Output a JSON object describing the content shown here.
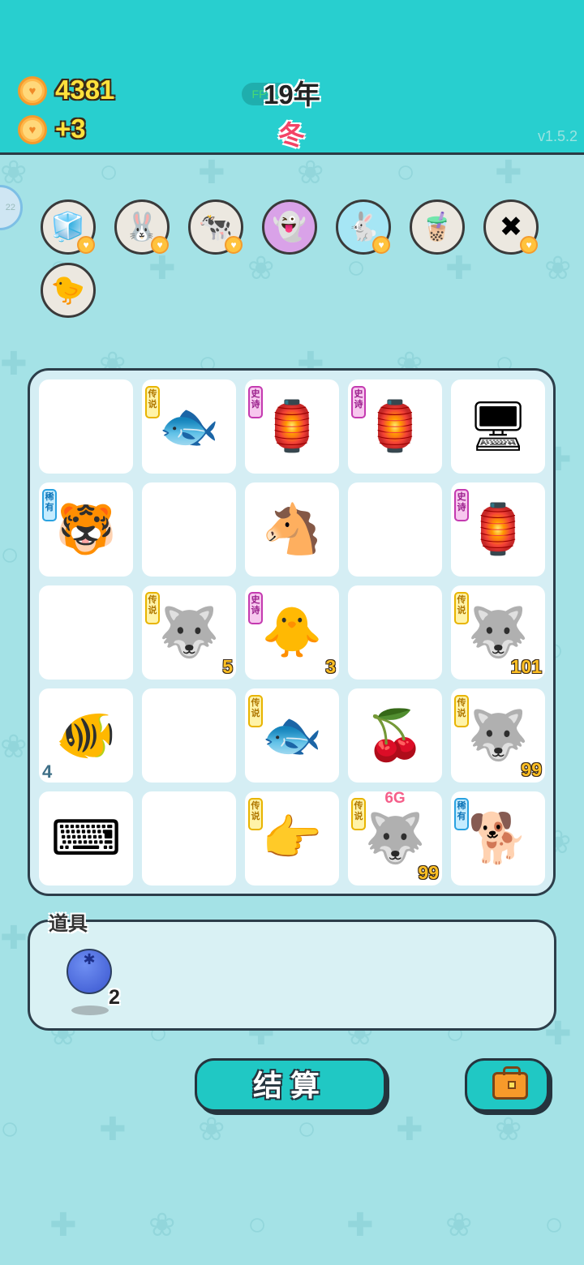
{
  "hud": {
    "coins": "4381",
    "income": "+3",
    "year": "19年",
    "season": "冬",
    "fps": "FPS:5",
    "version": "v1.5.2",
    "side_badge": "22"
  },
  "status_icons": [
    {
      "name": "sugar-cubes-icon",
      "glyph": "🧊",
      "heart": true
    },
    {
      "name": "rabbit-icon",
      "glyph": "🐰",
      "heart": true
    },
    {
      "name": "cow-pair-icon",
      "glyph": "🐄",
      "heart": true
    },
    {
      "name": "ghost-icon",
      "glyph": "👻",
      "heart": false
    },
    {
      "name": "rabbit-blue-icon",
      "glyph": "🐇",
      "heart": true
    },
    {
      "name": "bubble-tea-icon",
      "glyph": "🧋",
      "heart": false
    },
    {
      "name": "delete-tag-icon",
      "glyph": "✖",
      "heart": true
    },
    {
      "name": "chick-egg-icon",
      "glyph": "🐤",
      "heart": false
    }
  ],
  "rarity_labels": {
    "legend": "传说",
    "epic": "史诗",
    "rare": "稀有"
  },
  "board": [
    {
      "symbol": "",
      "name": "empty-cell",
      "rarity": null,
      "count": null
    },
    {
      "symbol": "🐟",
      "name": "koi-fish",
      "rarity": "legend",
      "count": null
    },
    {
      "symbol": "🏮",
      "name": "rabbit-lantern-tent",
      "rarity": "epic",
      "count": null
    },
    {
      "symbol": "🏮",
      "name": "rabbit-lantern-tent",
      "rarity": "epic",
      "count": null
    },
    {
      "symbol": "🖥",
      "name": "computer-monitor",
      "rarity": null,
      "count": null
    },
    {
      "symbol": "🐯",
      "name": "tiger",
      "rarity": "rare",
      "count": null
    },
    {
      "symbol": "",
      "name": "empty-cell",
      "rarity": null,
      "count": null
    },
    {
      "symbol": "🐴",
      "name": "horse",
      "rarity": null,
      "count": null
    },
    {
      "symbol": "",
      "name": "empty-cell",
      "rarity": null,
      "count": null
    },
    {
      "symbol": "🏮",
      "name": "rabbit-lantern-tent",
      "rarity": "epic",
      "count": null
    },
    {
      "symbol": "",
      "name": "empty-cell",
      "rarity": null,
      "count": null
    },
    {
      "symbol": "🐺",
      "name": "husky-king",
      "rarity": "legend",
      "count": "5"
    },
    {
      "symbol": "🐥",
      "name": "yellow-chick",
      "rarity": "epic",
      "count": "3"
    },
    {
      "symbol": "",
      "name": "empty-cell",
      "rarity": null,
      "count": null
    },
    {
      "symbol": "🐺",
      "name": "husky-king",
      "rarity": "legend",
      "count": "101"
    },
    {
      "symbol": "🐠",
      "name": "goldfish",
      "rarity": null,
      "count_left": "4"
    },
    {
      "symbol": "",
      "name": "empty-cell",
      "rarity": null,
      "count": null
    },
    {
      "symbol": "🐟",
      "name": "koi-fish",
      "rarity": "legend",
      "count": null
    },
    {
      "symbol": "🍒",
      "name": "cherry",
      "rarity": null,
      "count": null
    },
    {
      "symbol": "🐺",
      "name": "husky-king",
      "rarity": "legend",
      "count": "99"
    },
    {
      "symbol": "⌨",
      "name": "keyboard",
      "rarity": null,
      "count": null
    },
    {
      "symbol": "",
      "name": "empty-cell",
      "rarity": null,
      "count": null
    },
    {
      "symbol": "👉",
      "name": "pointing-hand",
      "rarity": "legend",
      "count": null
    },
    {
      "symbol": "🐺",
      "name": "husky-king-6g",
      "rarity": "legend",
      "count": "99",
      "tag": "6G"
    },
    {
      "symbol": "🐕",
      "name": "husky",
      "rarity": "rare",
      "count": null
    }
  ],
  "items": {
    "title": "道具",
    "list": [
      {
        "name": "blueberry",
        "glyph": "✱",
        "count": "2"
      }
    ]
  },
  "buttons": {
    "settle": "结算"
  },
  "colors": {
    "header": "#28cfcf",
    "background": "#a4e2e6",
    "accent": "#20c8c4",
    "coin": "#ffb84a",
    "count_text": "#ffc024"
  }
}
